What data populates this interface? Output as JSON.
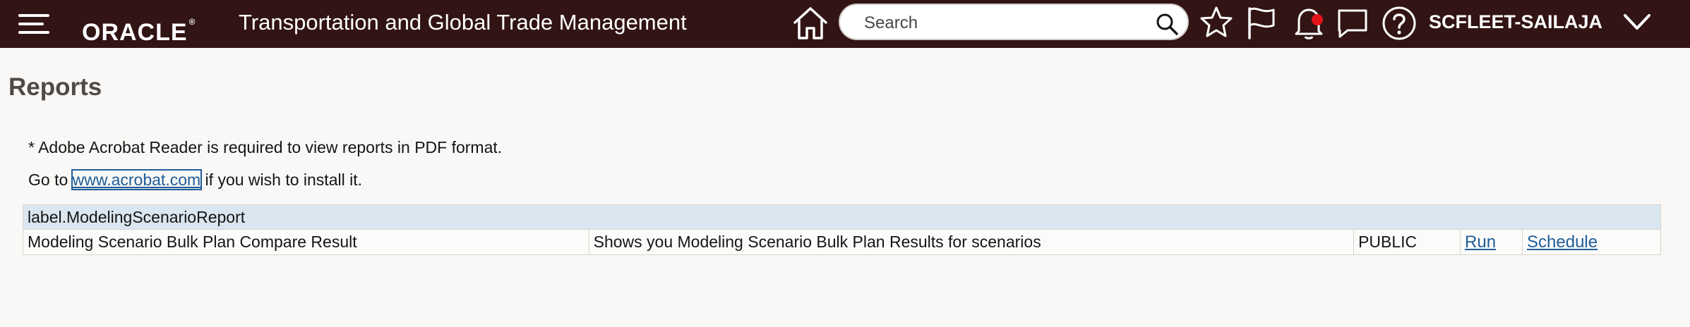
{
  "header": {
    "logo": "ORACLE",
    "logo_mark": "®",
    "product": "Transportation and Global Trade Management",
    "search_placeholder": "Search",
    "username": "SCFLEET-SAILAJA",
    "colors": {
      "bar": "#321414",
      "notification_dot": "#e3131a"
    },
    "icons": [
      "hamburger-menu-icon",
      "home-icon",
      "search-icon",
      "star-icon",
      "flag-icon",
      "bell-icon",
      "chat-icon",
      "help-icon",
      "chevron-down-icon"
    ]
  },
  "page": {
    "title": "Reports",
    "note_line1": "* Adobe Acrobat Reader is required to view reports in PDF format.",
    "note_line2_prefix": "Go to ",
    "note_link": "www.acrobat.com",
    "note_line2_suffix": " if you wish to install it."
  },
  "table": {
    "group_label": "label.ModelingScenarioReport",
    "rows": [
      {
        "name": "Modeling Scenario Bulk Plan Compare Result",
        "description": "Shows you Modeling Scenario Bulk Plan Results for scenarios",
        "visibility": "PUBLIC",
        "run": "Run",
        "schedule": "Schedule"
      }
    ]
  }
}
